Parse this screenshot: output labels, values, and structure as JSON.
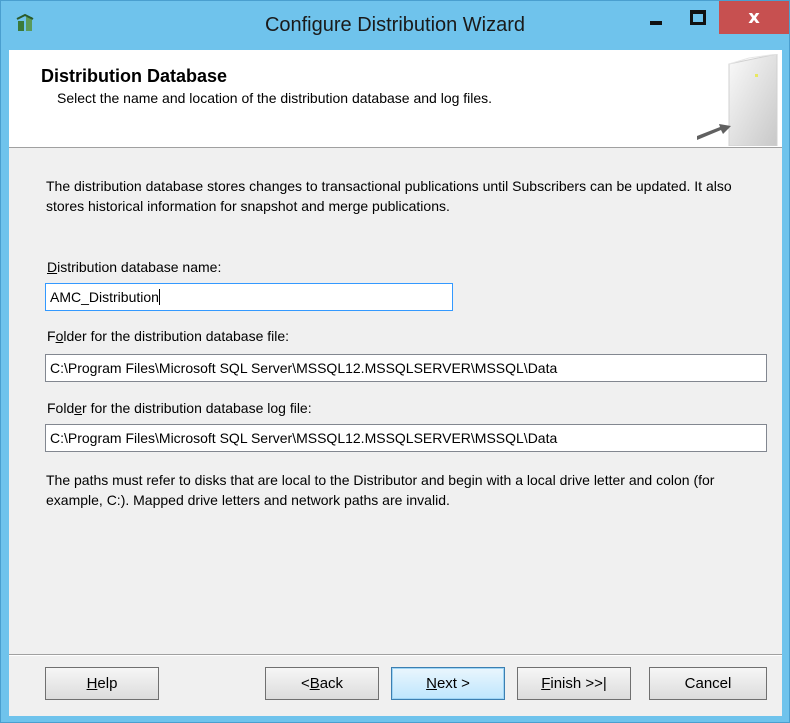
{
  "window": {
    "title": "Configure Distribution Wizard",
    "close_glyph": "x"
  },
  "header": {
    "title": "Distribution Database",
    "subtitle": "Select the name and location of the distribution database and log files."
  },
  "body": {
    "description": "The distribution database stores changes to transactional publications until Subscribers can be updated. It also stores historical information for snapshot and merge publications.",
    "db_name": {
      "label_key": "D",
      "label_rest": "istribution database name:",
      "value": "AMC_Distribution"
    },
    "data_folder": {
      "label_pre": "F",
      "label_key": "o",
      "label_rest": "lder for the distribution database file:",
      "value": "C:\\Program Files\\Microsoft SQL Server\\MSSQL12.MSSQLSERVER\\MSSQL\\Data"
    },
    "log_folder": {
      "label_pre": "Fold",
      "label_key": "e",
      "label_rest": "r for the distribution database log file:",
      "value": "C:\\Program Files\\Microsoft SQL Server\\MSSQL12.MSSQLSERVER\\MSSQL\\Data"
    },
    "note": "The paths must refer to disks that are local to the Distributor and begin with a local drive letter and colon (for example, C:). Mapped drive letters and network paths are invalid."
  },
  "buttons": {
    "help": {
      "key": "H",
      "rest": "elp"
    },
    "back": {
      "pre": "< ",
      "key": "B",
      "rest": "ack"
    },
    "next": {
      "key": "N",
      "rest": "ext >"
    },
    "finish": {
      "key": "F",
      "rest": "inish >>|"
    },
    "cancel": {
      "label": "Cancel"
    }
  },
  "colors": {
    "titlebar": "#6fc3ec",
    "close_button": "#c75050",
    "dialog_background": "#f0f0f0",
    "focus_border": "#3399ff"
  }
}
